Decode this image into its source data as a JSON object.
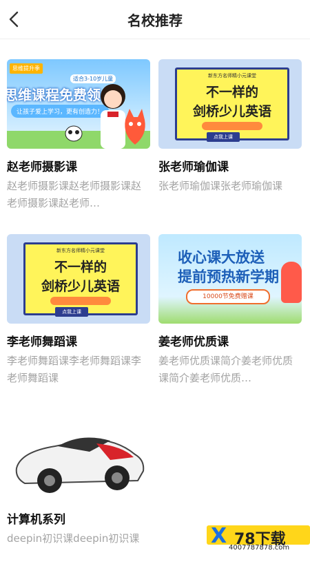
{
  "header": {
    "back_icon": "chevron-left-icon",
    "title": "名校推荐"
  },
  "cards": [
    {
      "title": "赵老师摄影课",
      "desc": "赵老师摄影课赵老师摄影课赵老师摄影课赵老师…",
      "banner": {
        "tag": "思维提升季",
        "sub": "适合3-10岁儿童",
        "big": "思维课程免费领",
        "pill": "让孩子爱上学习，更有创造力！"
      }
    },
    {
      "title": "张老师瑜伽课",
      "desc": "张老师瑜伽课张老师瑜伽课",
      "banner": {
        "top": "新东方名师精小元课堂",
        "line1": "不一样的",
        "line2": "剑桥少儿英语",
        "btn": "点我上课"
      }
    },
    {
      "title": "李老师舞蹈课",
      "desc": "李老师舞蹈课李老师舞蹈课李老师舞蹈课",
      "banner": {
        "top": "新东方名师精小元课堂",
        "line1": "不一样的",
        "line2": "剑桥少儿英语",
        "btn": "点我上课"
      }
    },
    {
      "title": "姜老师优质课",
      "desc": "姜老师优质课简介姜老师优质课简介姜老师优质…",
      "banner": {
        "line1": "收心课大放送",
        "line2": "提前预热新学期",
        "ribbon": "10000节免费赠课"
      }
    },
    {
      "title": "计算机系列",
      "desc": "deepin初识课deepin初识课"
    }
  ],
  "watermark": {
    "text": "78下载",
    "url": "4007787878.com"
  },
  "colors": {
    "accent_blue": "#1d5fb8",
    "board_yellow": "#fff45a",
    "muted_text": "#a3a3a3"
  }
}
